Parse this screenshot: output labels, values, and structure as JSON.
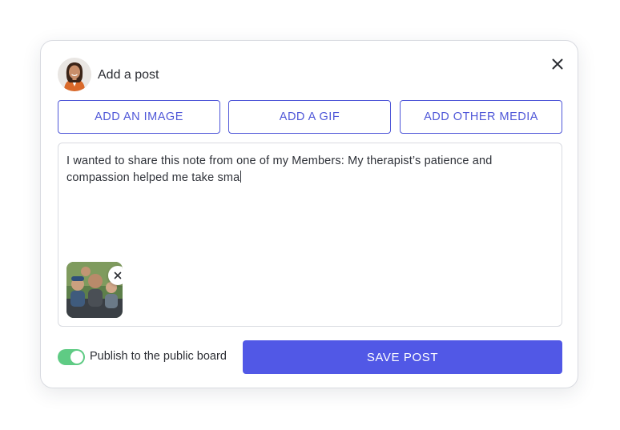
{
  "dialog": {
    "title": "Add a post",
    "close_icon": "close-icon"
  },
  "media_buttons": {
    "image_label": "ADD AN IMAGE",
    "gif_label": "ADD A GIF",
    "other_label": "ADD OTHER MEDIA"
  },
  "composer": {
    "text": "I wanted to share this note from one of my Members: My therapist’s patience and compassion helped me take sma",
    "attachment_remove_icon": "close-icon"
  },
  "footer": {
    "publish_label": "Publish to the public board",
    "publish_enabled": true,
    "save_label": "SAVE POST"
  },
  "colors": {
    "accent": "#5158e6",
    "outline_button": "#4f57d8",
    "toggle_on": "#5fcb84"
  }
}
